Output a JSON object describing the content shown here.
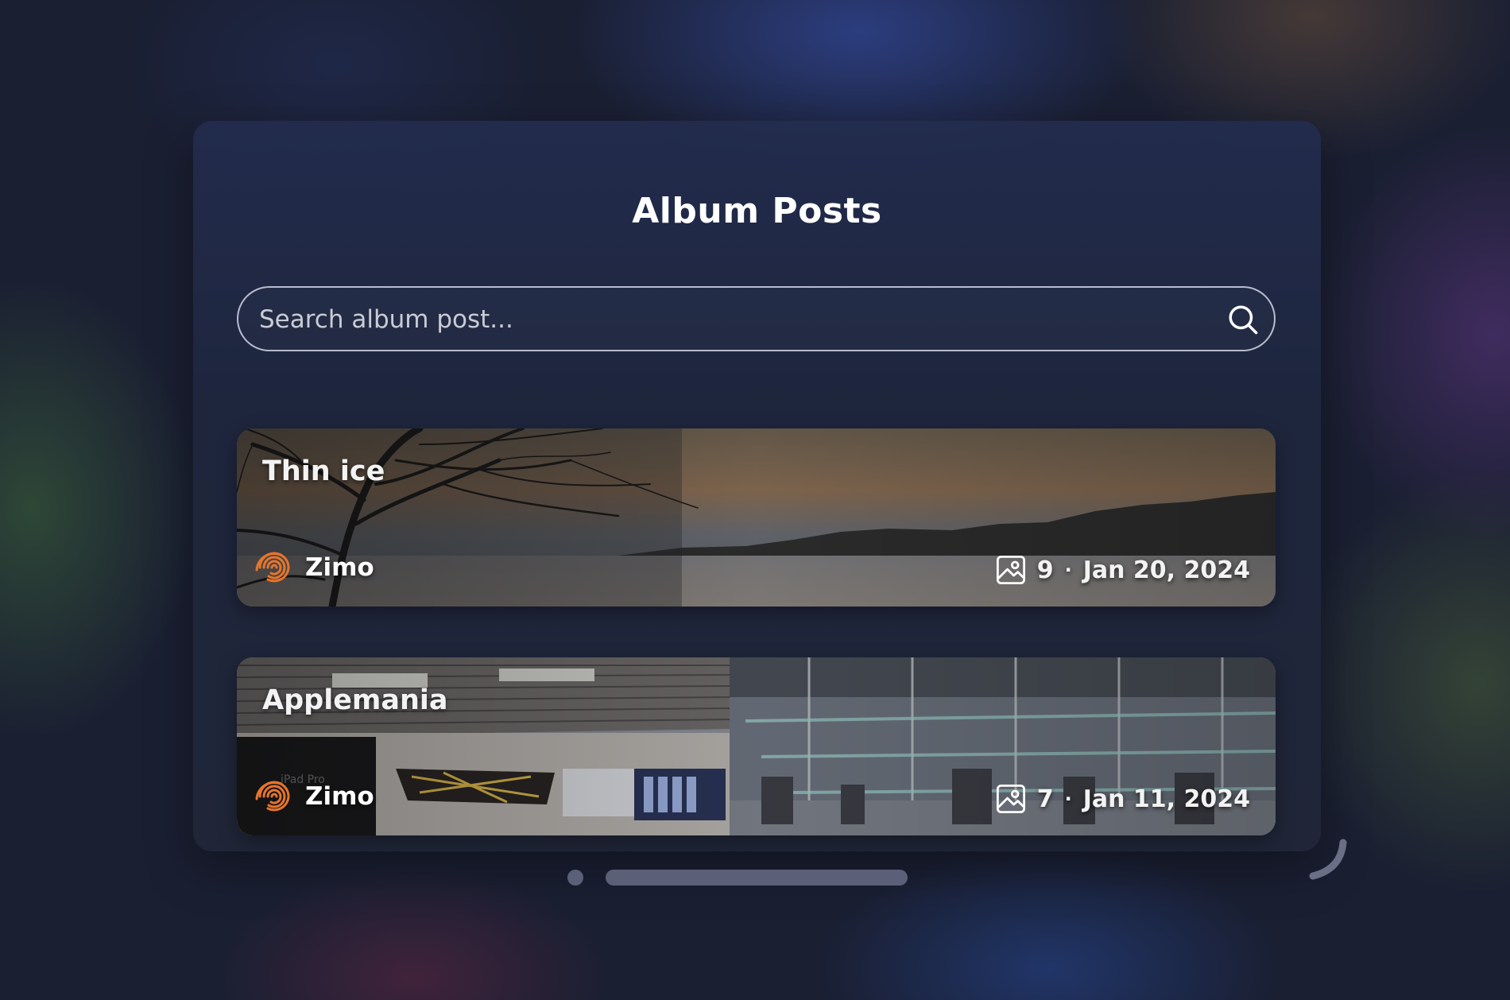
{
  "header": {
    "title": "Album Posts"
  },
  "search": {
    "placeholder": "Search album post...",
    "value": "",
    "icon": "search-icon"
  },
  "posts": [
    {
      "title": "Thin ice",
      "author": "Zimo",
      "photo_count": "9",
      "separator": "·",
      "date": "Jan 20, 2024",
      "icon": "photo-icon"
    },
    {
      "title": "Applemania",
      "author": "Zimo",
      "photo_count": "7",
      "separator": "·",
      "date": "Jan 11, 2024",
      "icon": "photo-icon"
    }
  ],
  "colors": {
    "background": "#1a1f32",
    "panel": "#1e2642",
    "text": "#ffffff",
    "avatar_accent": "#e8752a",
    "scrollbar": "#5b6078"
  }
}
